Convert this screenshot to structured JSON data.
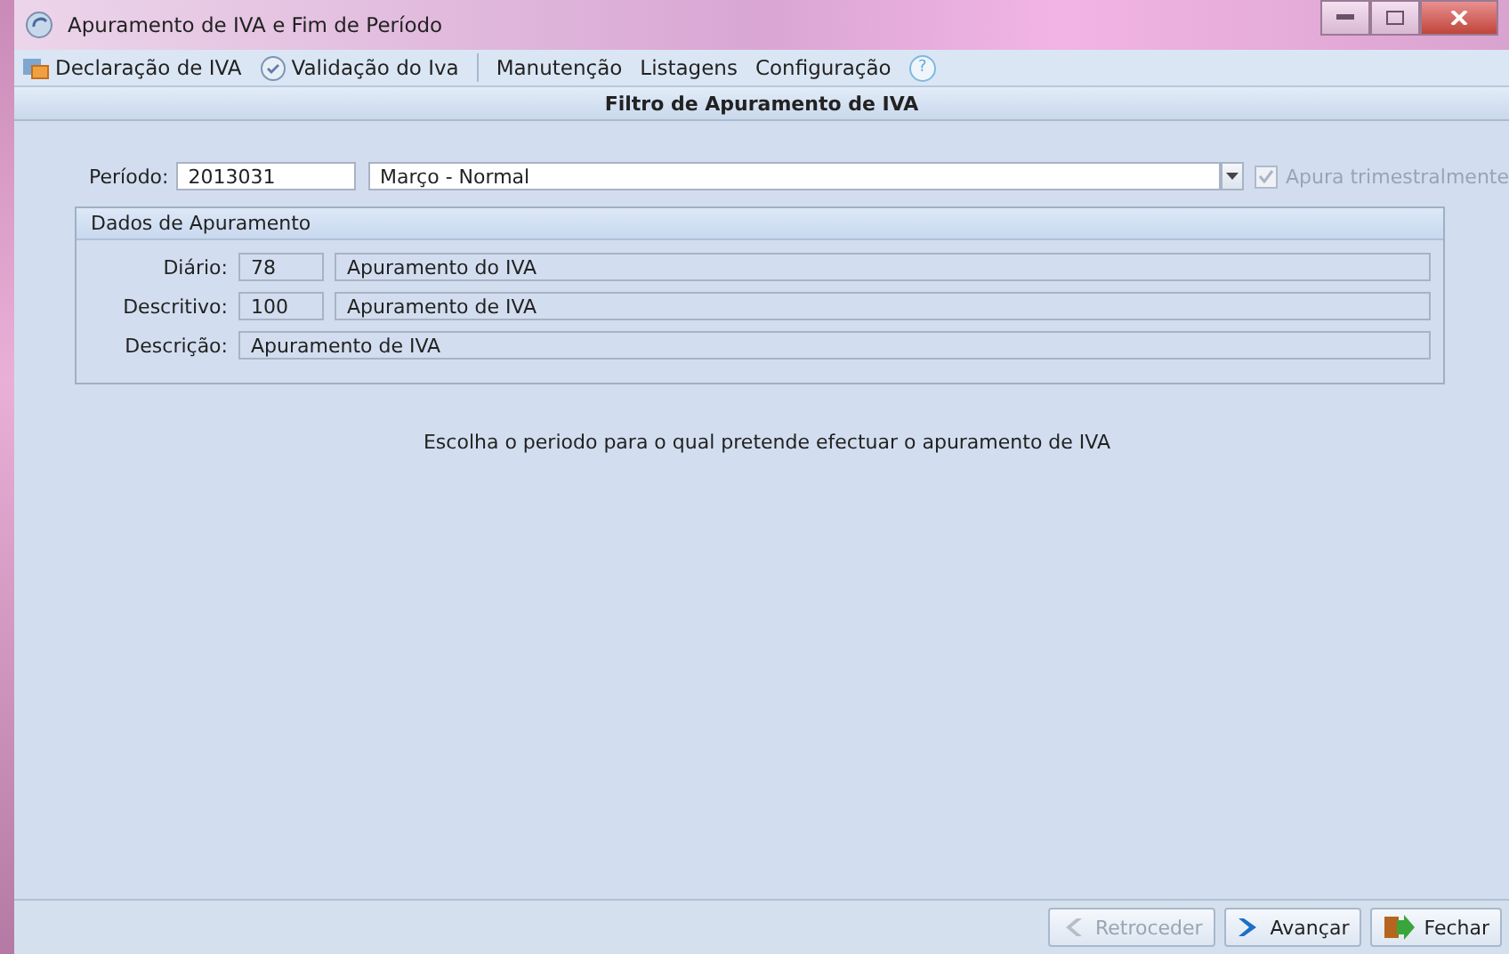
{
  "window": {
    "title": "Apuramento de IVA e Fim de Período"
  },
  "menu": [
    {
      "label": "Declaração de IVA",
      "kind": "folder"
    },
    {
      "label": "Validação do Iva",
      "kind": "check"
    },
    {
      "label": "Manutenção",
      "kind": "plain",
      "separator_before": true
    },
    {
      "label": "Listagens",
      "kind": "plain"
    },
    {
      "label": "Configuração",
      "kind": "plain"
    }
  ],
  "help": "?",
  "header": "Filtro de Apuramento de IVA",
  "period": {
    "label": "Período:",
    "code": "2013031",
    "name": "Março - Normal"
  },
  "checkbox": {
    "label": "Apura trimestralmente",
    "checked": true,
    "disabled": true
  },
  "group": {
    "title": "Dados de Apuramento",
    "rows": [
      {
        "label": "Diário:",
        "code": "78",
        "value": "Apuramento do IVA"
      },
      {
        "label": "Descritivo:",
        "code": "100",
        "value": "Apuramento de IVA"
      },
      {
        "label": "Descrição:",
        "value": "Apuramento de IVA"
      }
    ]
  },
  "message": "Escolha o periodo para o qual pretende efectuar o apuramento de IVA",
  "buttons": [
    {
      "label": "Retroceder",
      "kind": "back",
      "disabled": true
    },
    {
      "label": "Avançar",
      "kind": "next",
      "disabled": false
    },
    {
      "label": "Fechar",
      "kind": "close",
      "disabled": false
    }
  ]
}
